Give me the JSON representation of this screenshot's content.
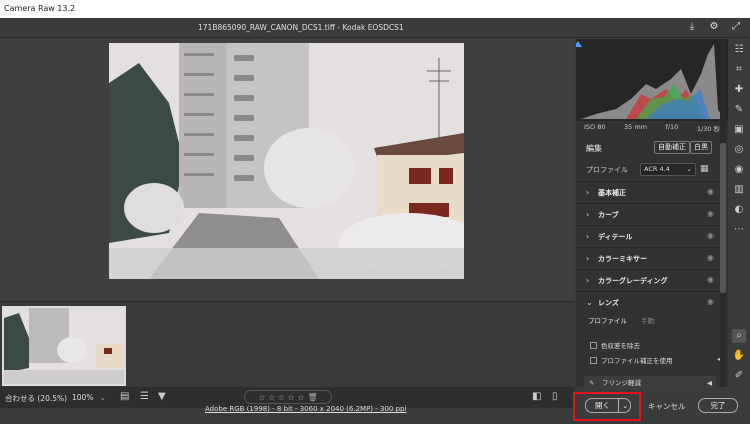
{
  "window": {
    "title": "Camera Raw 13.2"
  },
  "document": {
    "title": "171B865090_RAW_CANON_DCS1.tiff - Kodak EOSDCS1"
  },
  "top_icons": [
    "save-icon",
    "gear-icon",
    "expand-icon"
  ],
  "camera_info": {
    "iso": "ISO 80",
    "focal": "35 mm",
    "aperture": "f/10",
    "shutter": "1/30 秒"
  },
  "edit_panel": {
    "heading": "編集",
    "auto_button": "自動補正",
    "bw_button": "白黒",
    "profile_label": "プロファイル",
    "profile_value": "ACR 4.4",
    "sections": [
      "基本補正",
      "カーブ",
      "ディテール",
      "カラーミキサー",
      "カラーグレーディング",
      "レンズ"
    ],
    "lens": {
      "tabs": [
        "プロファイル",
        "手動"
      ],
      "checkbox_remove_ca": "色収差を除去",
      "checkbox_profile": "プロファイル補正を使用",
      "fringe": "フリンジ軽減"
    }
  },
  "bottom": {
    "zoom_label": "合わせる (20.5%)",
    "zoom_value": "100%",
    "stars": "☆ ☆ ☆ ☆ ☆"
  },
  "footer": {
    "info_link": "Adobe RGB (1998) - 8 bit - 3060 x 2040 (6.2MP) - 300 ppi",
    "open_button": "開く",
    "cancel_button": "キャンセル",
    "done_button": "完了"
  },
  "colors": {
    "highlight_box": "#e3151a",
    "panel_bg": "#323232",
    "app_bg": "#3b3b3b"
  }
}
